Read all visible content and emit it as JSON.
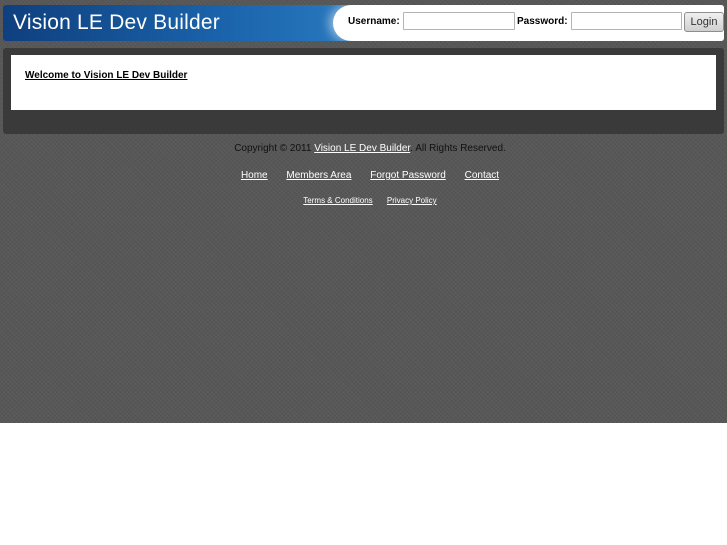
{
  "header": {
    "title": "Vision LE Dev Builder",
    "username_label": "Username:",
    "username_value": "",
    "password_label": "Password:",
    "password_value": "",
    "login_label": "Login"
  },
  "content": {
    "welcome_text": "Welcome to Vision LE Dev Builder"
  },
  "footer": {
    "copyright_prefix": "Copyright © 2011",
    "copyright_link": "Vision LE Dev Builder",
    "copyright_suffix": ". All Rights Reserved.",
    "nav": {
      "home": "Home",
      "members": "Members Area",
      "forgot": "Forgot Password",
      "contact": "Contact"
    },
    "legal": {
      "terms": "Terms & Conditions",
      "privacy": "Privacy Policy"
    }
  }
}
